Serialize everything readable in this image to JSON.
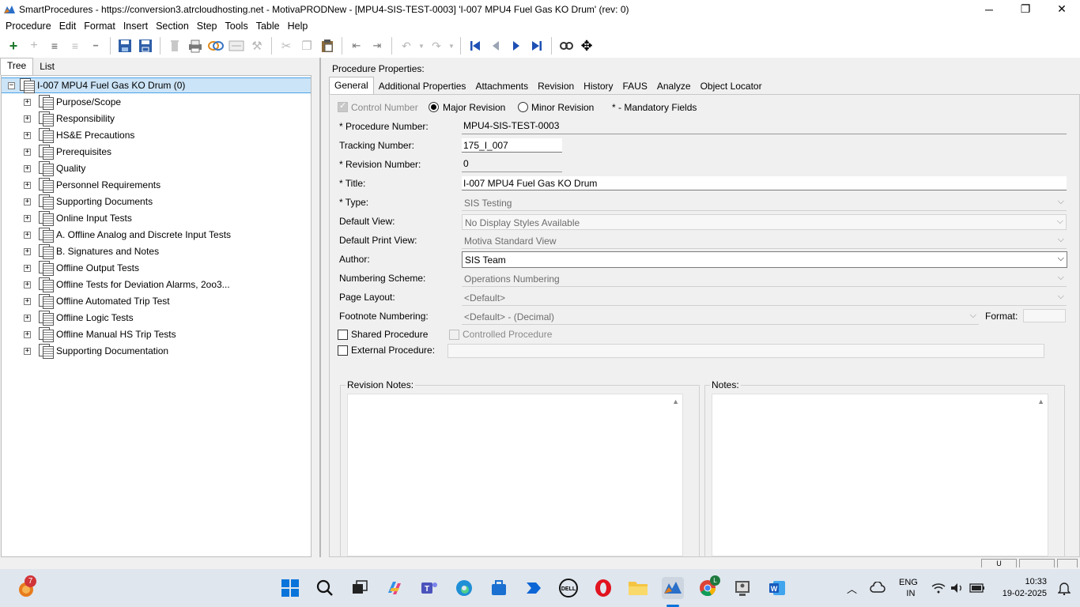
{
  "window": {
    "title": "SmartProcedures - https://conversion3.atrcloudhosting.net - MotivaPRODNew - [MPU4-SIS-TEST-0003] 'I-007 MPU4 Fuel Gas KO Drum' (rev: 0)",
    "minimize": "─",
    "maximize": "❐",
    "close": "✕"
  },
  "menu": [
    "Procedure",
    "Edit",
    "Format",
    "Insert",
    "Section",
    "Step",
    "Tools",
    "Table",
    "Help"
  ],
  "toolbar": {
    "add": "+",
    "add_child": "+",
    "indent": "≡",
    "outdent": "≡",
    "remove": "━",
    "save_all": "💾",
    "save": "💾",
    "nav_first": "⏮",
    "nav_prev": "◀",
    "nav_next": "▶",
    "nav_last": "⏭",
    "move": "✥"
  },
  "left_tabs": [
    "Tree",
    "List"
  ],
  "tree": {
    "root": "I-007 MPU4 Fuel Gas KO Drum (0)",
    "items": [
      "Purpose/Scope",
      "Responsibility",
      "HS&E Precautions",
      "Prerequisites",
      "Quality",
      "Personnel Requirements",
      "Supporting Documents",
      "Online Input Tests",
      "A. Offline Analog and Discrete Input Tests",
      "B. Signatures and Notes",
      "Offline Output Tests",
      "Offline Tests for Deviation Alarms, 2oo3...",
      "Offline Automated Trip Test",
      "Offline Logic Tests",
      "Offline Manual HS Trip Tests",
      "Supporting Documentation"
    ]
  },
  "props": {
    "header": "Procedure Properties:",
    "tabs": [
      "General",
      "Additional Properties",
      "Attachments",
      "Revision",
      "History",
      "FAUS",
      "Analyze",
      "Object Locator"
    ],
    "control_number": "Control Number",
    "major_revision": "Major Revision",
    "minor_revision": "Minor Revision",
    "mandatory_note": "* - Mandatory Fields",
    "labels": {
      "procedure_number": "* Procedure Number:",
      "tracking_number": "Tracking Number:",
      "revision_number": "* Revision Number:",
      "title": "* Title:",
      "type": "* Type:",
      "default_view": "Default View:",
      "default_print_view": "Default Print View:",
      "author": "Author:",
      "numbering_scheme": "Numbering Scheme:",
      "page_layout": "Page Layout:",
      "footnote_numbering": "Footnote Numbering:",
      "format": "Format:",
      "shared_procedure": "Shared Procedure",
      "controlled_procedure": "Controlled Procedure",
      "external_procedure": "External Procedure:",
      "revision_notes": "Revision Notes:",
      "notes": "Notes:"
    },
    "values": {
      "procedure_number": "MPU4-SIS-TEST-0003",
      "tracking_number": "175_I_007",
      "revision_number": "0",
      "title": "I-007 MPU4 Fuel Gas KO Drum",
      "type": "SIS Testing",
      "default_view": "No Display Styles Available",
      "default_print_view": "Motiva Standard View",
      "author": "SIS Team",
      "numbering_scheme": "Operations Numbering",
      "page_layout": "<Default>",
      "footnote_numbering": "<Default> - (Decimal)",
      "format": "",
      "external_procedure": ""
    }
  },
  "status": {
    "cell1": "U"
  },
  "taskbar": {
    "notification_count": "7",
    "lang": "ENG",
    "region": "IN",
    "time": "10:33",
    "date": "19-02-2025"
  },
  "colors": {
    "selection": "#cce4f7",
    "selection_border": "#4aa3e8",
    "nav_blue": "#1e4fb3",
    "taskbar": "#dfe6ee"
  }
}
